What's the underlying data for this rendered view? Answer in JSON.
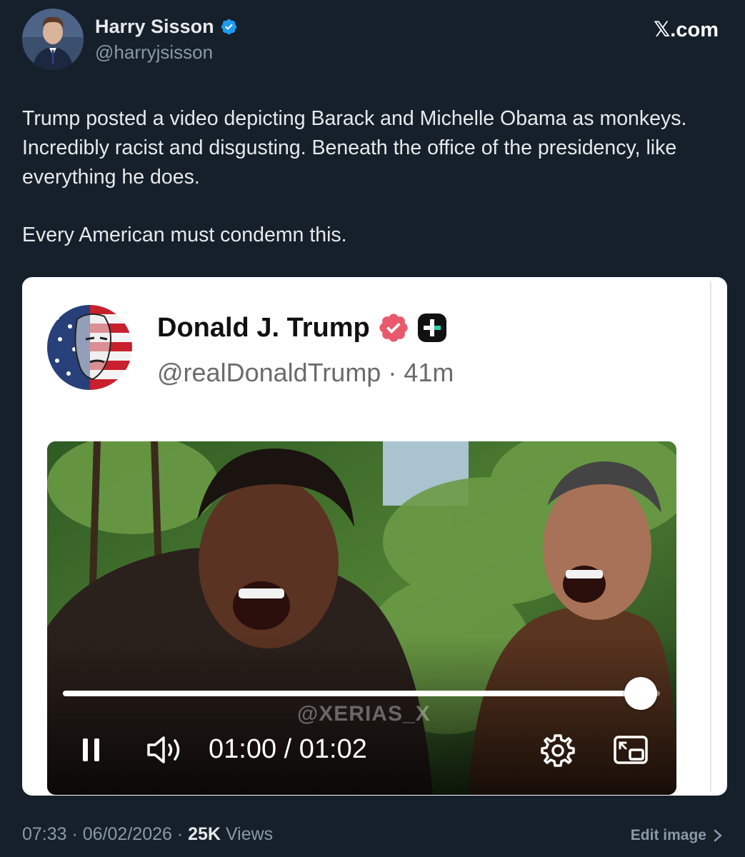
{
  "header": {
    "author_name": "Harry Sisson",
    "author_handle": "@harryjsisson",
    "site_label": "𝕏.com"
  },
  "tweet": {
    "paragraph_1": "Trump posted a video depicting Barack and Michelle Obama as monkeys. Incredibly racist and disgusting. Beneath the office of the presidency, like everything he does.",
    "paragraph_2": "Every American must condemn this."
  },
  "embedded_post": {
    "author_name": "Donald J. Trump",
    "author_handle": "@realDonaldTrump · 41m",
    "video": {
      "watermark": "@XERIAS_X",
      "time_readout": "01:00 / 01:02",
      "progress_fraction": 0.968
    }
  },
  "footer": {
    "time": "07:33 · 06/02/2026 · ",
    "views_count": "25K",
    "views_label": " Views",
    "edit_image_label": "Edit image"
  },
  "colors": {
    "background": "#15202b",
    "verified_blue": "#1d9bf0",
    "truth_badge": "#e8596b"
  },
  "icons": [
    "verified-badge-icon",
    "truth-plus-icon",
    "pause-icon",
    "volume-icon",
    "settings-icon",
    "pip-icon",
    "chevron-right-icon"
  ]
}
